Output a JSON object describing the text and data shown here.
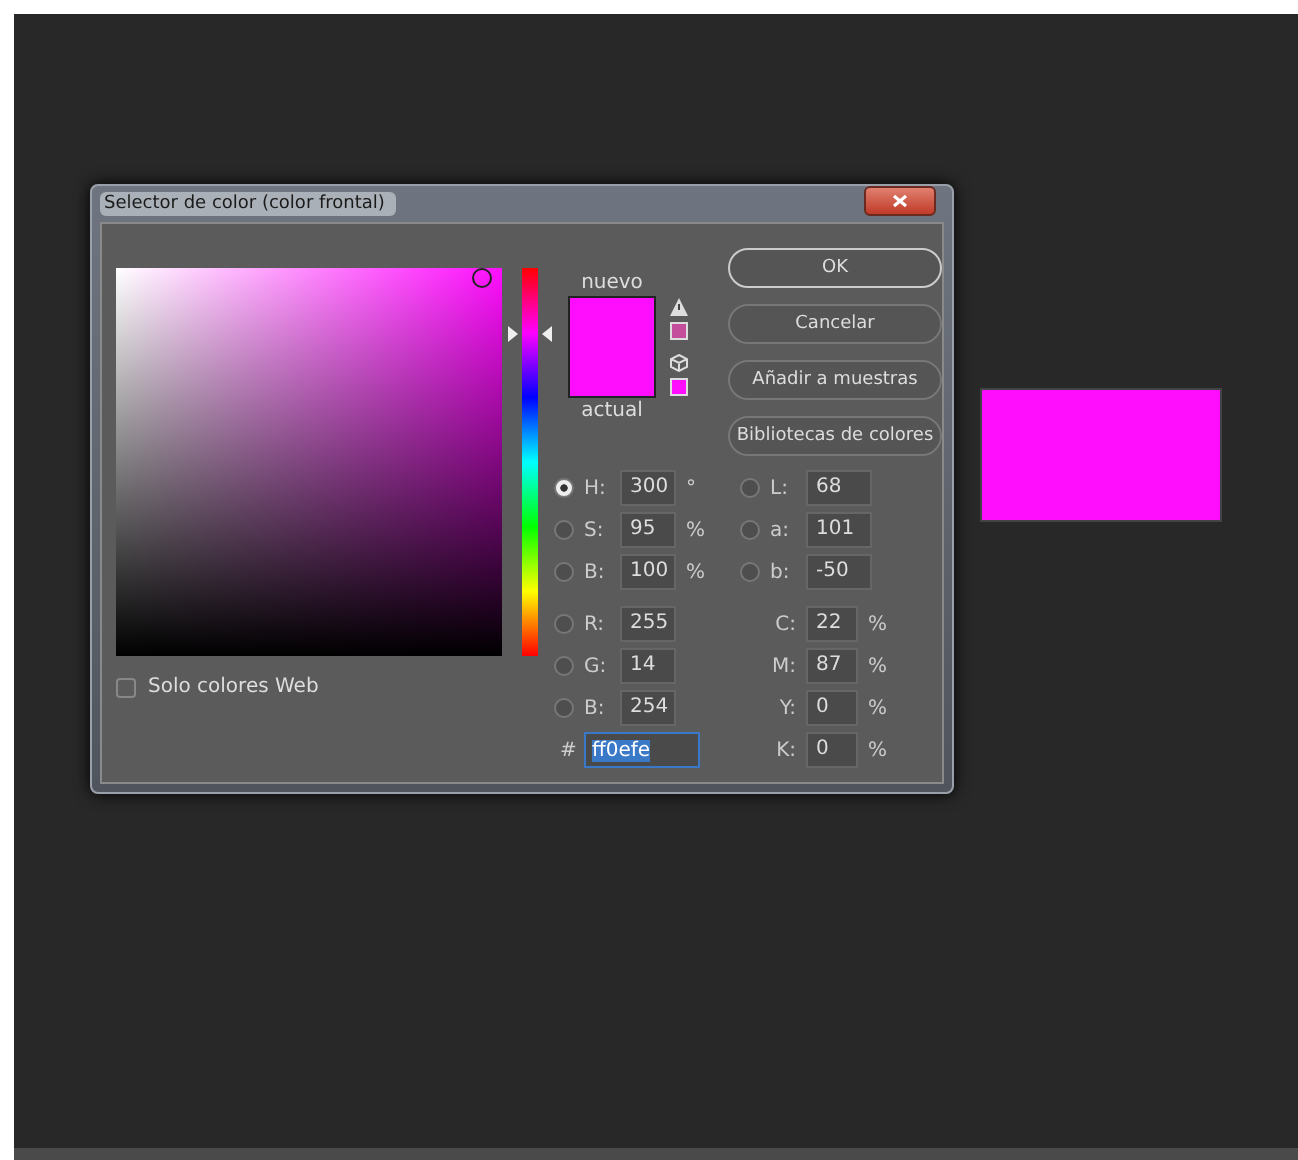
{
  "window": {
    "title": "Selector de color (color frontal)"
  },
  "buttons": [
    {
      "label": "OK",
      "default": true
    },
    {
      "label": "Cancelar",
      "default": false
    },
    {
      "label": "Añadir a muestras",
      "default": false
    },
    {
      "label": "Bibliotecas de colores",
      "default": false
    }
  ],
  "swatch": {
    "new_label": "nuevo",
    "current_label": "actual"
  },
  "hue_slider": {
    "level": 0.83
  },
  "web_only": {
    "label": "Solo colores Web",
    "checked": false
  },
  "values_left": [
    {
      "kind": "radio",
      "label": "H:",
      "value": "300",
      "unit": "°",
      "selected": true
    },
    {
      "kind": "radio",
      "label": "S:",
      "value": "95",
      "unit": "%",
      "selected": false
    },
    {
      "kind": "radio",
      "label": "B:",
      "value": "100",
      "unit": "%",
      "selected": false
    },
    {
      "kind": "radio",
      "label": "R:",
      "value": "255",
      "selected": false
    },
    {
      "kind": "radio",
      "label": "G:",
      "value": "14",
      "selected": false
    },
    {
      "kind": "radio",
      "label": "B:",
      "value": "254",
      "selected": false
    }
  ],
  "hex": {
    "label": "#",
    "value": "ff0efe"
  },
  "values_right": [
    {
      "kind": "radio",
      "label": "L:",
      "value": "68",
      "selected": false
    },
    {
      "kind": "radio",
      "label": "a:",
      "value": "101",
      "selected": false
    },
    {
      "kind": "radio",
      "label": "b:",
      "value": "-50",
      "selected": false
    },
    {
      "kind": "plain",
      "label": "C:",
      "value": "22",
      "unit": "%"
    },
    {
      "kind": "plain",
      "label": "M:",
      "value": "87",
      "unit": "%"
    },
    {
      "kind": "plain",
      "label": "Y:",
      "value": "0",
      "unit": "%"
    },
    {
      "kind": "plain",
      "label": "K:",
      "value": "0",
      "unit": "%"
    }
  ]
}
